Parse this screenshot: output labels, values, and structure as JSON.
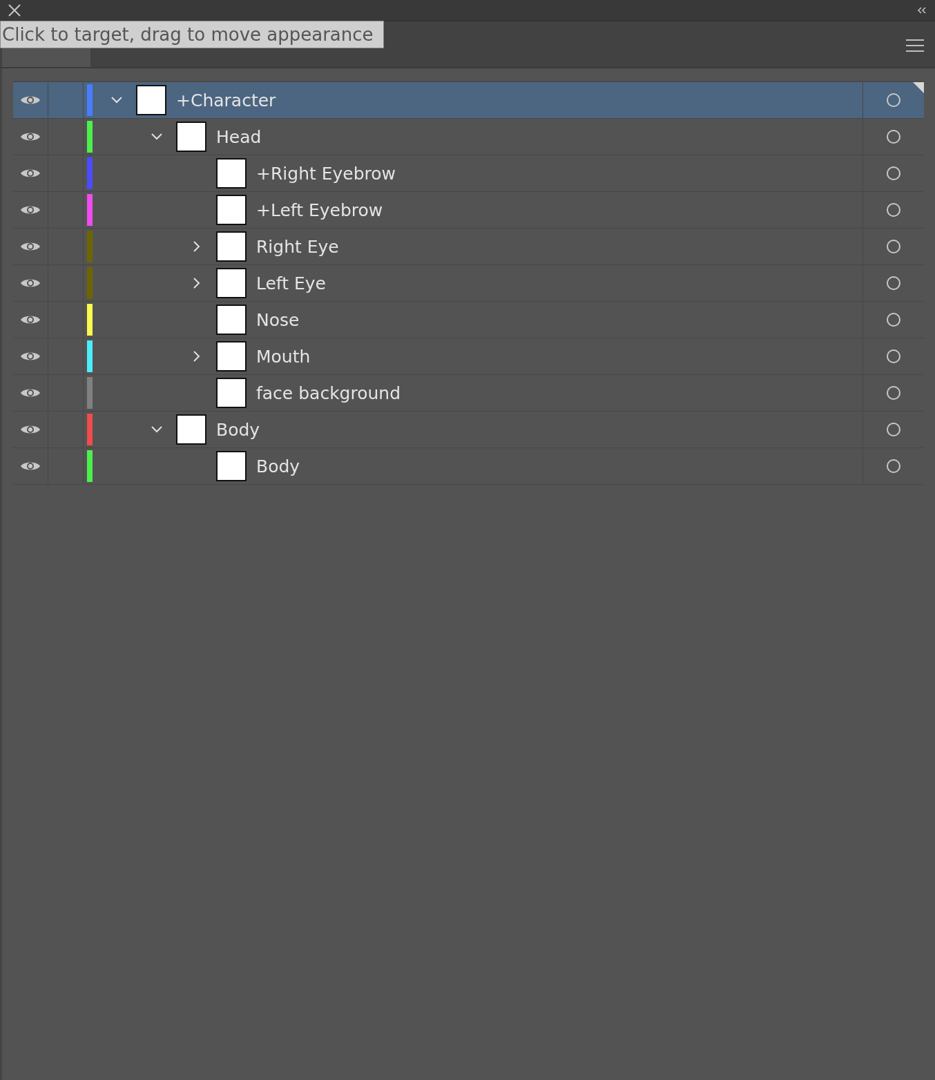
{
  "tooltip": {
    "text": "Click to target, drag to move appearance"
  },
  "layers": [
    {
      "name": "+Character",
      "color": "#4a7cff",
      "kind": "group",
      "expanded": true,
      "selected": true,
      "children": [
        {
          "name": "Head",
          "color": "#4cf04c",
          "kind": "group",
          "expanded": true,
          "selected": false,
          "children": [
            {
              "name": "+Right Eyebrow",
              "color": "#4b4bff",
              "kind": "item",
              "selected": false
            },
            {
              "name": "+Left Eyebrow",
              "color": "#f04cf0",
              "kind": "item",
              "selected": false
            },
            {
              "name": "Right Eye",
              "color": "#6e6500",
              "kind": "group",
              "expanded": false,
              "selected": false
            },
            {
              "name": "Left Eye",
              "color": "#6e6500",
              "kind": "group",
              "expanded": false,
              "selected": false
            },
            {
              "name": "Nose",
              "color": "#fafa4c",
              "kind": "item",
              "selected": false
            },
            {
              "name": "Mouth",
              "color": "#4cecfa",
              "kind": "group",
              "expanded": false,
              "selected": false
            },
            {
              "name": "face background",
              "color": "#808080",
              "kind": "item",
              "selected": false
            }
          ]
        },
        {
          "name": "Body",
          "color": "#f04c4c",
          "kind": "group",
          "expanded": true,
          "selected": false,
          "children": [
            {
              "name": "Body",
              "color": "#4cf04c",
              "kind": "item",
              "selected": false
            }
          ]
        }
      ]
    }
  ]
}
